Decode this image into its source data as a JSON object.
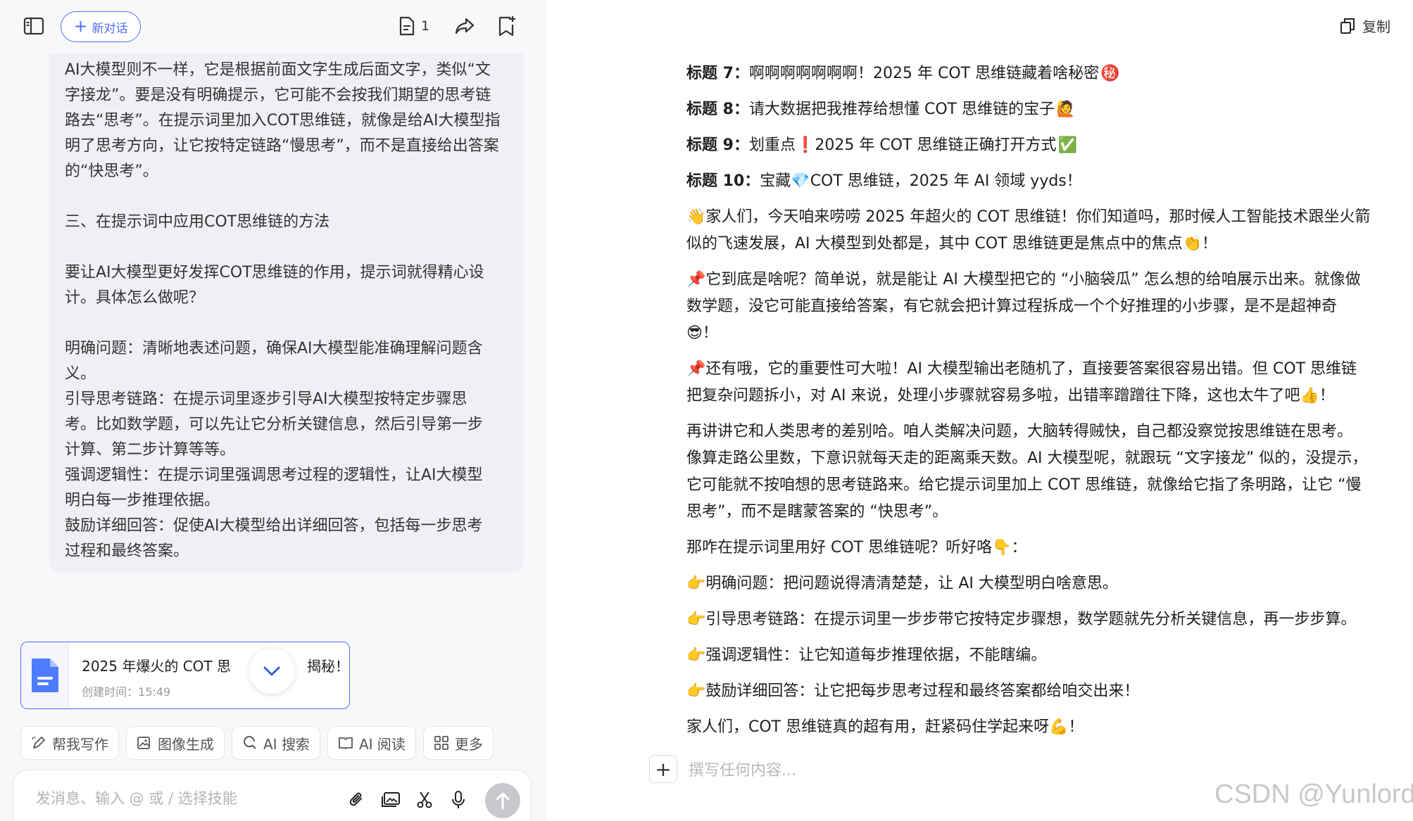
{
  "left_panel": {
    "new_chat_label": "新对话",
    "doc_count": "1",
    "message_paragraphs": [
      [
        "AI大模型则不一样，它是根据前面文字生成后面文字，类似“文",
        "字接龙”。要是没有明确提示，它可能不会按我们期望的思考链",
        "路去“思考”。在提示词里加入COT思维链，就像是给AI大模型指",
        "明了思考方向，让它按特定链路“慢思考”，而不是直接给出答案",
        "的“快思考”。"
      ],
      [
        "三、在提示词中应用COT思维链的方法"
      ],
      [
        "要让AI大模型更好发挥COT思维链的作用，提示词就得精心设",
        "计。具体怎么做呢？"
      ],
      [
        "明确问题：清晰地表述问题，确保AI大模型能准确理解问题含",
        "义。",
        "引导思考链路：在提示词里逐步引导AI大模型按特定步骤思",
        "考。比如数学题，可以先让它分析关键信息，然后引导第一步",
        "计算、第二步计算等等。",
        "强调逻辑性：在提示词里强调思考过程的逻辑性，让AI大模型",
        "明白每一步推理依据。",
        "鼓励详细回答：促使AI大模型给出详细回答，包括每一步思考",
        "过程和最终答案。"
      ]
    ],
    "doc_card": {
      "title_left": "2025 年爆火的 COT 思",
      "title_right": "揭秘！",
      "time_label": "创建时间：15:49"
    },
    "skills": [
      {
        "icon": "pen-icon",
        "label": "帮我写作"
      },
      {
        "icon": "image-icon",
        "label": "图像生成"
      },
      {
        "icon": "search-icon",
        "label": "AI 搜索"
      },
      {
        "icon": "book-icon",
        "label": "AI 阅读"
      },
      {
        "icon": "grid-icon",
        "label": "更多"
      }
    ],
    "input_placeholder": "发消息、输入 @ 或 / 选择技能"
  },
  "right_panel": {
    "copy_label": "复制",
    "titles": [
      {
        "label": "标题 7",
        "text": "啊啊啊啊啊啊啊！2025 年 COT 思维链藏着啥秘密",
        "emoji": "㊙️"
      },
      {
        "label": "标题 8",
        "text": "请大数据把我推荐给想懂 COT 思维链的宝子",
        "emoji": "🙋"
      },
      {
        "label": "标题 9",
        "text": "划重点❗2025 年 COT 思维链正确打开方式",
        "emoji": "✅"
      },
      {
        "label": "标题 10",
        "text": "宝藏💎COT 思维链，2025 年 AI 领域 yyds！",
        "emoji": ""
      }
    ],
    "paragraphs": [
      [
        "👋家人们，今天咱来唠唠 2025 年超火的 COT 思维链！你们知道吗，那时候人工智能技术跟坐火箭",
        "似的飞速发展，AI 大模型到处都是，其中 COT 思维链更是焦点中的焦点👏！"
      ],
      [
        "📌它到底是啥呢？简单说，就是能让 AI 大模型把它的 “小脑袋瓜” 怎么想的给咱展示出来。就像做",
        "数学题，没它可能直接给答案，有它就会把计算过程拆成一个个好推理的小步骤，是不是超神奇",
        "😎！"
      ],
      [
        "📌还有哦，它的重要性可大啦！AI 大模型输出老随机了，直接要答案很容易出错。但 COT 思维链",
        "把复杂问题拆小，对 AI 来说，处理小步骤就容易多啦，出错率蹭蹭往下降，这也太牛了吧👍！"
      ],
      [
        "再讲讲它和人类思考的差别哈。咱人类解决问题，大脑转得贼快，自己都没察觉按思维链在思考。",
        "像算走路公里数，下意识就每天走的距离乘天数。AI 大模型呢，就跟玩 “文字接龙” 似的，没提示，",
        "它可能就不按咱想的思考链路来。给它提示词里加上 COT 思维链，就像给它指了条明路，让它 “慢",
        "思考”，而不是瞎蒙答案的 “快思考”。"
      ],
      [
        "那咋在提示词里用好 COT 思维链呢？听好咯👇："
      ],
      [
        "👉明确问题：把问题说得清清楚楚，让 AI 大模型明白啥意思。"
      ],
      [
        "👉引导思考链路：在提示词里一步步带它按特定步骤想，数学题就先分析关键信息，再一步步算。"
      ],
      [
        "👉强调逻辑性：让它知道每步推理依据，不能瞎编。"
      ],
      [
        "👉鼓励详细回答：让它把每步思考过程和最终答案都给咱交出来！"
      ],
      [
        "家人们，COT 思维链真的超有用，赶紧码住学起来呀💪！"
      ]
    ],
    "editor_placeholder": "撰写任何内容...",
    "watermark": "CSDN @Yunlord"
  }
}
